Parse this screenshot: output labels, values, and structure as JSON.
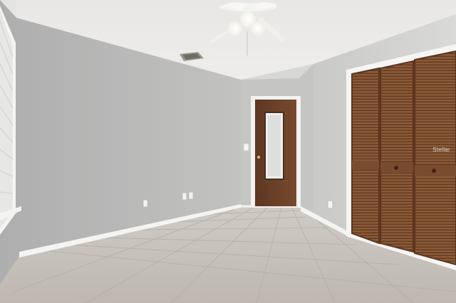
{
  "scene": {
    "description_tags": [
      "empty-bedroom",
      "ceiling-fan",
      "tile-floor",
      "louvered-closet-doors",
      "wood-entry-door"
    ],
    "watermark": "Stellar",
    "colors": {
      "wall_left": "#b9b9b8",
      "wall_back": "#c4c4c3",
      "wall_right": "#cfcfcd",
      "ceiling": "#ecebe9",
      "floor": "#c9c4bd",
      "door_wood": "#6b4028",
      "closet_wood": "#8a5a38",
      "trim": "#f4f4f2"
    }
  }
}
